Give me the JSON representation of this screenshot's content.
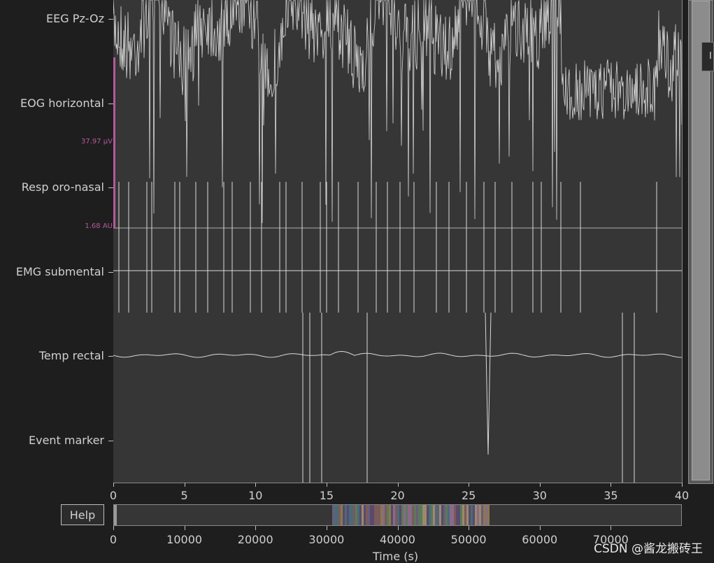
{
  "channels": [
    {
      "label": "EEG Pz-Oz"
    },
    {
      "label": "EOG horizontal"
    },
    {
      "label": "Resp oro-nasal"
    },
    {
      "label": "EMG submental"
    },
    {
      "label": "Temp rectal"
    },
    {
      "label": "Event marker"
    }
  ],
  "scales": {
    "eog": "37.97 µV",
    "resp": "1.68 AU"
  },
  "time_axis": {
    "ticks": [
      "0",
      "5",
      "10",
      "15",
      "20",
      "25",
      "30",
      "35",
      "40"
    ],
    "min": 0,
    "max": 40
  },
  "overview": {
    "ticks": [
      "0",
      "10000",
      "20000",
      "30000",
      "40000",
      "50000",
      "60000",
      "70000"
    ],
    "min": 0,
    "max": 80000
  },
  "xaxis_label": "Time (s)",
  "help_label": "Help",
  "tooltip_text": "I",
  "watermark": "CSDN @酱龙搬砖王",
  "colors": {
    "trace": "#d9d9d9",
    "scale": "#b35a9a",
    "panel": "#363636",
    "background": "#1e1e1e"
  }
}
